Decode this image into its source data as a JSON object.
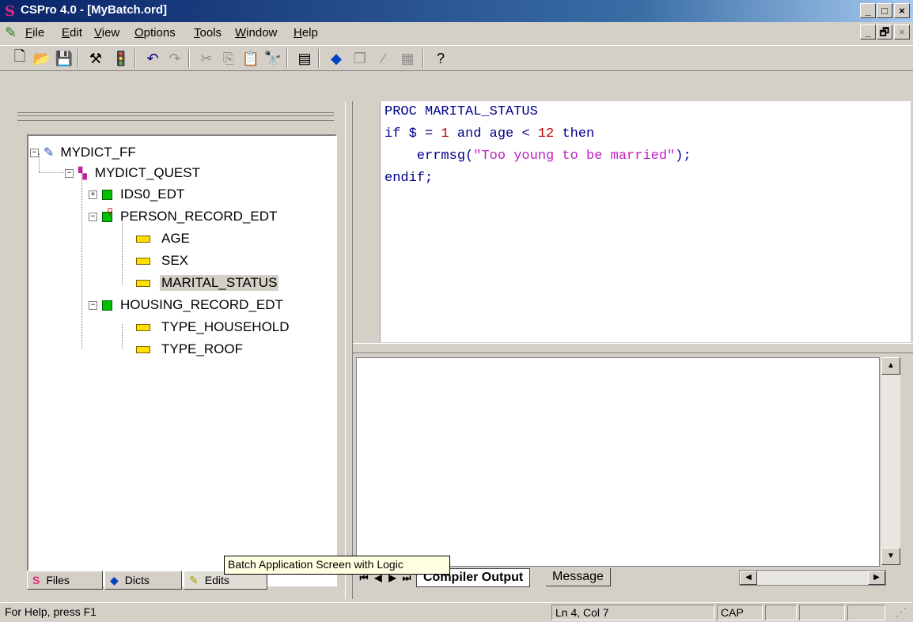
{
  "window": {
    "title": "CSPro 4.0 - [MyBatch.ord]",
    "app_icon": "S",
    "min": "_",
    "max": "□",
    "close": "×",
    "restore": "🗗"
  },
  "menu": [
    {
      "label": "File",
      "key": "F"
    },
    {
      "label": "Edit",
      "key": "E"
    },
    {
      "label": "View",
      "key": "V"
    },
    {
      "label": "Options",
      "key": "O"
    },
    {
      "label": "Tools",
      "key": "T"
    },
    {
      "label": "Window",
      "key": "W"
    },
    {
      "label": "Help",
      "key": "H"
    }
  ],
  "toolbar": {
    "icons": [
      "new-icon",
      "open-icon",
      "save-icon",
      "compile-icon",
      "run-icon",
      "undo-icon",
      "redo-icon",
      "cut-icon",
      "copy-icon",
      "paste-icon",
      "find-icon",
      "document-icon",
      "dictionary-icon",
      "forms-icon",
      "pencil-icon",
      "layout-icon",
      "help-icon"
    ]
  },
  "tree": {
    "items": [
      {
        "label": "MYDICT_FF"
      },
      {
        "label": "MYDICT_QUEST"
      },
      {
        "label": "IDS0_EDT"
      },
      {
        "label": "PERSON_RECORD_EDT"
      },
      {
        "label": "AGE"
      },
      {
        "label": "SEX"
      },
      {
        "label": "MARITAL_STATUS"
      },
      {
        "label": "HOUSING_RECORD_EDT"
      },
      {
        "label": "TYPE_HOUSEHOLD"
      },
      {
        "label": "TYPE_ROOF"
      }
    ]
  },
  "left_tabs": {
    "files": "Files",
    "dicts": "Dicts",
    "edits": "Edits"
  },
  "tooltip": "Batch Application Screen with Logic",
  "code": {
    "line1": "PROC MARITAL_STATUS",
    "line2_a": "if $ = ",
    "line2_b": "1",
    "line2_c": " and age < ",
    "line2_d": "12",
    "line2_e": " then",
    "line3_a": "    errmsg(",
    "line3_b": "\"Too young to be married\"",
    "line3_c": ");",
    "line4": "endif;"
  },
  "output_tabs": {
    "compiler": "Compiler Output",
    "message": "Message"
  },
  "statusbar": {
    "help": "For Help, press F1",
    "position": "Ln 4, Col 7",
    "cap": "CAP"
  }
}
